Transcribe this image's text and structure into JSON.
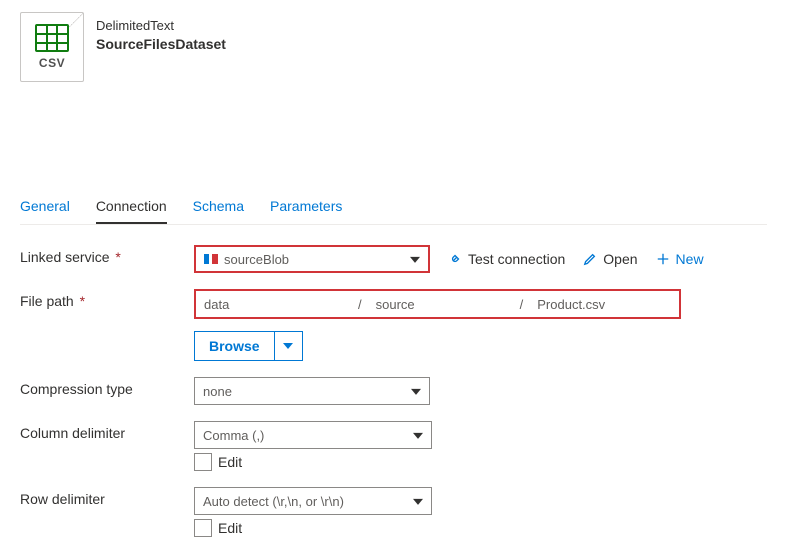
{
  "header": {
    "icon_badge": "CSV",
    "type": "DelimitedText",
    "name": "SourceFilesDataset"
  },
  "tabs": {
    "items": [
      {
        "id": "general",
        "label": "General"
      },
      {
        "id": "connection",
        "label": "Connection"
      },
      {
        "id": "schema",
        "label": "Schema"
      },
      {
        "id": "parameters",
        "label": "Parameters"
      }
    ],
    "active": "connection"
  },
  "form": {
    "linked_service": {
      "label": "Linked service",
      "required": "*",
      "value": "sourceBlob",
      "actions": {
        "test": "Test connection",
        "open": "Open",
        "new": "New"
      }
    },
    "file_path": {
      "label": "File path",
      "required": "*",
      "container": "data",
      "folder": "source",
      "file": "Product.csv",
      "sep": "/",
      "browse": "Browse"
    },
    "compression_type": {
      "label": "Compression type",
      "value": "none"
    },
    "column_delimiter": {
      "label": "Column delimiter",
      "value": "Comma (,)",
      "edit": "Edit"
    },
    "row_delimiter": {
      "label": "Row delimiter",
      "value": "Auto detect (\\r,\\n, or \\r\\n)",
      "edit": "Edit"
    }
  }
}
